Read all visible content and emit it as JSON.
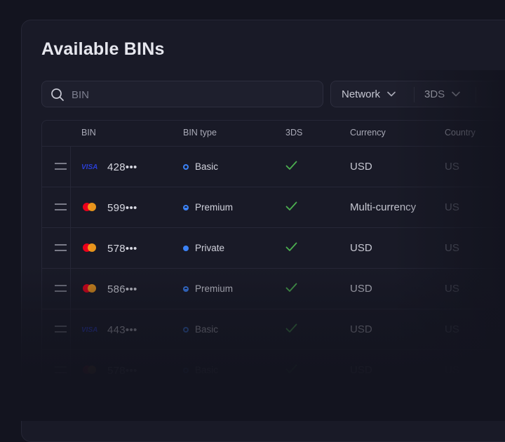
{
  "page": {
    "title": "Available BINs"
  },
  "search": {
    "placeholder": "BIN",
    "icon": "search-icon"
  },
  "filters": [
    {
      "label": "Network"
    },
    {
      "label": "3DS"
    }
  ],
  "table": {
    "columns": [
      "BIN",
      "BIN type",
      "3DS",
      "Currency",
      "Country"
    ],
    "rows": [
      {
        "network": "visa",
        "network_label": "VISA",
        "bin": "428•••",
        "type": "Basic",
        "three_ds": true,
        "currency": "USD",
        "country": "US"
      },
      {
        "network": "mastercard",
        "bin": "599•••",
        "type": "Premium",
        "three_ds": true,
        "currency": "Multi-currency",
        "country": "US"
      },
      {
        "network": "mastercard",
        "bin": "578•••",
        "type": "Private",
        "three_ds": true,
        "currency": "USD",
        "country": "US"
      },
      {
        "network": "mastercard",
        "bin": "586•••",
        "type": "Premium",
        "three_ds": true,
        "currency": "USD",
        "country": "US"
      },
      {
        "network": "visa",
        "network_label": "VISA",
        "bin": "443•••",
        "type": "Basic",
        "three_ds": true,
        "currency": "USD",
        "country": "US"
      },
      {
        "network": "mastercard",
        "bin": "578•••",
        "type": "Basic",
        "three_ds": true,
        "currency": "USD",
        "country": "US"
      }
    ]
  },
  "colors": {
    "background": "#13141f",
    "panel": "#191a27",
    "accent_blue": "#3b82f6",
    "check_green": "#4caf50",
    "visa_blue": "#2a3fd6",
    "mc_red": "#eb001b",
    "mc_orange": "#f79e1b"
  }
}
